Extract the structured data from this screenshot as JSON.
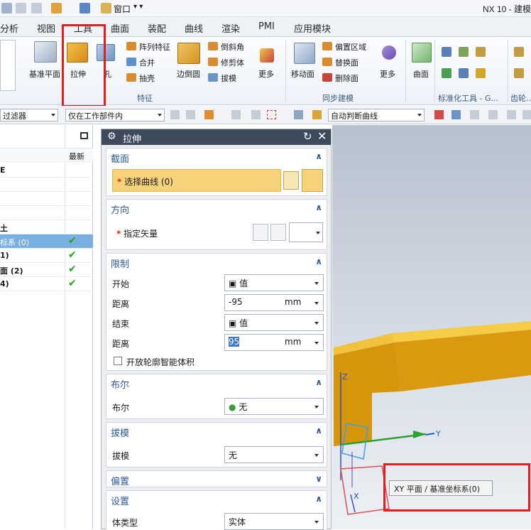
{
  "app_title": "NX 10 - 建模",
  "quick_access": {
    "window_label": "窗口"
  },
  "tabs": [
    "分析",
    "视图",
    "工具",
    "曲面",
    "装配",
    "曲线",
    "渲染",
    "PMI",
    "应用模块"
  ],
  "ribbon": {
    "datum_plane": "基准平面",
    "extrude": "拉伸",
    "hole": "孔",
    "pattern_feature": "阵列特征",
    "unite": "合并",
    "shell": "抽壳",
    "edge_blend": "边倒圆",
    "chamfer": "倒斜角",
    "trim_body": "修剪体",
    "draft": "拔模",
    "more_1": "更多",
    "move_face": "移动面",
    "offset_region": "偏置区域",
    "replace_face": "替换面",
    "delete_face": "删除面",
    "more_2": "更多",
    "surface": "曲面",
    "group_feature": "特征",
    "group_sync": "同步建模",
    "group_std": "标准化工具 - G...",
    "group_gear": "齿轮..."
  },
  "selection_bar": {
    "filter": "过滤器",
    "scope": "仅在工作部件内",
    "curve_rule": "自动判断曲线"
  },
  "navigator": {
    "col_latest": "最新",
    "rows": [
      {
        "text": "E",
        "check": false
      },
      {
        "text": "",
        "check": false
      },
      {
        "text": "",
        "check": false
      },
      {
        "text": "",
        "check": false
      },
      {
        "text": "土",
        "check": false
      },
      {
        "text": "标系 (0)",
        "check": true
      },
      {
        "text": "1)",
        "check": true
      },
      {
        "text": "面 (2)",
        "check": true
      },
      {
        "text": "4)",
        "check": true
      }
    ]
  },
  "dialog": {
    "title": "拉伸",
    "section_label": "截面",
    "select_curve": "选择曲线 (0)",
    "direction_label": "方向",
    "specify_vector": "指定矢量",
    "limits_label": "限制",
    "start_label": "开始",
    "start_value": "值",
    "distance_label_1": "距离",
    "distance_1_value": "-95",
    "distance_1_unit": "mm",
    "end_label": "结束",
    "end_value": "值",
    "distance_label_2": "距离",
    "distance_2_value": "95",
    "distance_2_unit": "mm",
    "open_profile": "开放轮廓智能体积",
    "boolean_section": "布尔",
    "boolean_label": "布尔",
    "boolean_value": "无",
    "draft_section": "拔模",
    "draft_label": "拔模",
    "draft_value": "无",
    "offset_section": "偏置",
    "settings_section": "设置",
    "body_type_label": "体类型",
    "body_type_value": "实体"
  },
  "viewport": {
    "tooltip": "XY 平面 / 基准坐标系(0)",
    "axis_x": "X",
    "axis_y": "Y",
    "axis_z": "Z"
  },
  "colors": {
    "accent": "#2c5a96",
    "highlight": "#f6d27a",
    "selected_row": "#cfe3f7",
    "model": "#e3a300"
  }
}
